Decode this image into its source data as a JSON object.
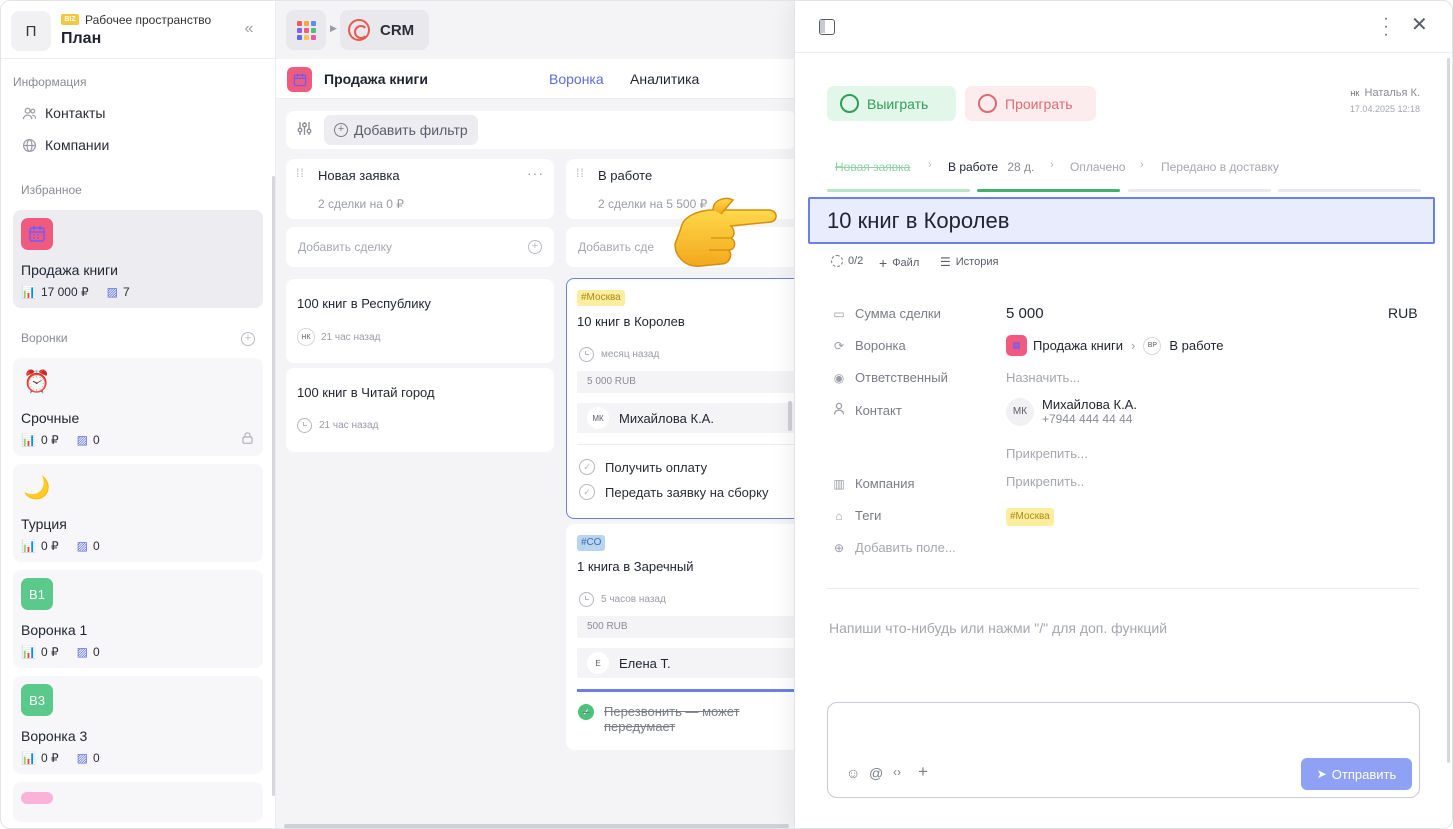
{
  "sidebar": {
    "workspace_badge": "BIZ",
    "workspace_label": "Рабочее пространство",
    "workspace_name": "План",
    "workspace_avatar": "П",
    "section_info": "Информация",
    "info_items": [
      {
        "label": "Контакты",
        "icon": "contacts-icon"
      },
      {
        "label": "Компании",
        "icon": "companies-icon"
      }
    ],
    "section_favorites": "Избранное",
    "favorite": {
      "name": "Продажа книги",
      "amount": "17 000 ₽",
      "count": "7"
    },
    "section_funnels": "Воронки",
    "funnels": [
      {
        "name": "Срочные",
        "amount": "0 ₽",
        "count": "0",
        "emoji": "⏰",
        "locked": true
      },
      {
        "name": "Турция",
        "amount": "0 ₽",
        "count": "0",
        "emoji": "🌙"
      },
      {
        "name": "Воронка 1",
        "amount": "0 ₽",
        "count": "0",
        "badge": "В1",
        "color": "#5bc98b"
      },
      {
        "name": "Воронка 3",
        "amount": "0 ₽",
        "count": "0",
        "badge": "В3",
        "color": "#5bc98b"
      }
    ]
  },
  "main": {
    "app_name": "CRM",
    "funnel_title": "Продажа книги",
    "tabs": [
      {
        "label": "Воронка",
        "active": true
      },
      {
        "label": "Аналитика",
        "active": false
      }
    ],
    "add_filter": "Добавить фильтр",
    "columns": [
      {
        "title": "Новая заявка",
        "summary": "2 сделки на 0 ₽",
        "add_deal": "Добавить сделку",
        "deals": [
          {
            "title": "100 книг в Республику",
            "avatar": "НК",
            "time": "21 час назад"
          },
          {
            "title": "100 книг в Читай город",
            "time": "21 час назад"
          }
        ]
      },
      {
        "title": "В работе",
        "summary": "2 сделки на 5 500 ₽",
        "add_deal": "Добавить сде",
        "deals": [
          {
            "tag": "#Москва",
            "title": "10 книг в Королев",
            "time": "месяц назад",
            "amount": "5 000 RUB",
            "resp_avatar": "МК",
            "resp_name": "Михайлова К.А.",
            "tasks": [
              {
                "label": "Получить оплату",
                "done": false
              },
              {
                "label": "Передать заявку на сборку",
                "done": false
              }
            ]
          },
          {
            "tag": "#СО",
            "title": "1 книга в Заречный",
            "time": "5 часов назад",
            "amount": "500 RUB",
            "resp_avatar": "Е",
            "resp_name": "Елена Т.",
            "tasks": [
              {
                "label": "Перезвонить — может передумает",
                "done": true
              }
            ]
          }
        ]
      }
    ]
  },
  "panel": {
    "win_label": "Выиграть",
    "lose_label": "Проиграть",
    "author_initials": "НК",
    "author_name": "Наталья К.",
    "author_date": "17.04.2025 12:18",
    "stages": [
      {
        "label": "Новая заявка",
        "state": "done"
      },
      {
        "label": "В работе",
        "state": "current",
        "days": "28 д."
      },
      {
        "label": "Оплачено",
        "state": "future"
      },
      {
        "label": "Передано в доставку",
        "state": "future"
      }
    ],
    "deal_title": "10 книг в Королев",
    "checklist": "0/2",
    "file_label": "Файл",
    "history_label": "История",
    "fields": {
      "amount_label": "Сумма сделки",
      "amount_value": "5 000",
      "currency": "RUB",
      "funnel_label": "Воронка",
      "funnel_value": "Продажа книги",
      "stage_initials": "ВР",
      "stage_value": "В работе",
      "responsible_label": "Ответственный",
      "responsible_placeholder": "Назначить...",
      "contact_label": "Контакт",
      "contact_initials": "МК",
      "contact_name": "Михайлова К.А.",
      "contact_phone": "+7944 444 44 44",
      "contact_attach": "Прикрепить...",
      "company_label": "Компания",
      "company_attach": "Прикрепить..",
      "tags_label": "Теги",
      "tag_value": "#Москва",
      "add_field": "Добавить поле..."
    },
    "comment_placeholder": "Напиши что-нибудь или нажми \"/\" для доп. функций",
    "send_label": "Отправить"
  },
  "colors": {
    "accent": "#5b6ce6",
    "win": "#2e9e57",
    "lose": "#e06a72",
    "tag_moscow": "#fbeea0",
    "tag_co": "#b9d4f0"
  }
}
